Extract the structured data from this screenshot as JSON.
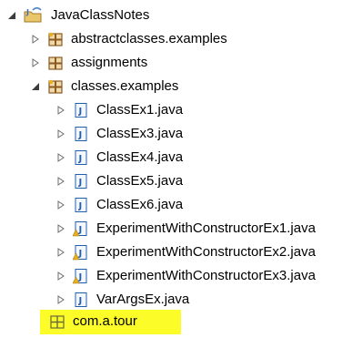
{
  "tree": {
    "root": {
      "label": "JavaClassNotes",
      "icon": "project-folder-icon",
      "expanded": true
    },
    "packages": [
      {
        "label": "abstractclasses.examples",
        "icon": "package-icon",
        "expanded": false
      },
      {
        "label": "assignments",
        "icon": "package-icon",
        "expanded": false
      },
      {
        "label": "classes.examples",
        "icon": "package-icon",
        "expanded": true
      }
    ],
    "files": [
      {
        "label": "ClassEx1.java",
        "icon": "java-file-icon"
      },
      {
        "label": "ClassEx3.java",
        "icon": "java-file-icon"
      },
      {
        "label": "ClassEx4.java",
        "icon": "java-file-icon"
      },
      {
        "label": "ClassEx5.java",
        "icon": "java-file-icon"
      },
      {
        "label": "ClassEx6.java",
        "icon": "java-file-icon"
      },
      {
        "label": "ExperimentWithConstructorEx1.java",
        "icon": "java-file-warning-icon"
      },
      {
        "label": "ExperimentWithConstructorEx2.java",
        "icon": "java-file-warning-icon"
      },
      {
        "label": "ExperimentWithConstructorEx3.java",
        "icon": "java-file-warning-icon"
      },
      {
        "label": "VarArgsEx.java",
        "icon": "java-file-icon"
      }
    ],
    "selected": {
      "label": "com.a.tour",
      "icon": "empty-package-icon"
    }
  },
  "colors": {
    "highlight": "#fcfc28",
    "package_brown": "#8a5a22",
    "java_blue": "#1f5fae",
    "warning": "#e8b020",
    "arrow": "#6b6b6b"
  }
}
